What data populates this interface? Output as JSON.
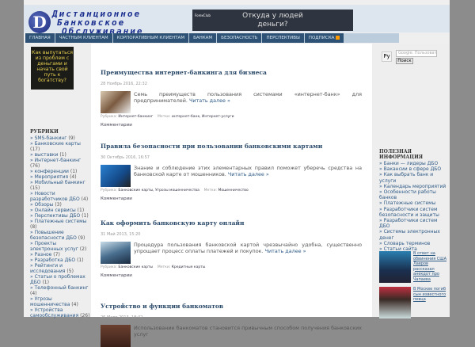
{
  "header": {
    "logo_letter": "D",
    "logo_lines": [
      "Дистанционное",
      "Банковское",
      "Обслуживание"
    ],
    "ad_brand": "ForexClub",
    "ad_text": "Откуда у людей деньги?"
  },
  "nav": [
    "ГЛАВНАЯ",
    "ЧАСТНЫМ КЛИЕНТАМ",
    "КОРПОРАТИВНЫМ КЛИЕНТАМ",
    "БАНКАМ",
    "БЕЗОПАСНОСТЬ",
    "ПЕРСПЕКТИВЫ",
    "ПОДПИСКА"
  ],
  "left": {
    "promo": "Как выпутаться из проблем с деньгами и начать свой путь к богатству?",
    "rubrics_title": "РУБРИКИ",
    "rubrics": [
      {
        "label": "SMS-банкинг",
        "count": "(9)"
      },
      {
        "label": "Банковские карты",
        "count": "(17)"
      },
      {
        "label": "выставки",
        "count": "(1)"
      },
      {
        "label": "Интернет-банкинг",
        "count": "(76)"
      },
      {
        "label": "конференции",
        "count": "(1)"
      },
      {
        "label": "Мероприятия",
        "count": "(4)"
      },
      {
        "label": "Мобильный банкинг",
        "count": "(15)"
      },
      {
        "label": "Новости разработчиков ДБО",
        "count": "(4)"
      },
      {
        "label": "Обзоры",
        "count": "(3)"
      },
      {
        "label": "Онлайн сервисы",
        "count": "(1)"
      },
      {
        "label": "Перспективы ДБО",
        "count": "(1)"
      },
      {
        "label": "Платежные системы",
        "count": "(8)"
      },
      {
        "label": "Повышение безопасности ДБО",
        "count": "(9)"
      },
      {
        "label": "Проекты электронных услуг",
        "count": "(2)"
      },
      {
        "label": "Разное",
        "count": "(7)"
      },
      {
        "label": "Разработка ДБО",
        "count": "(1)"
      },
      {
        "label": "Рейтинги и исследования",
        "count": "(5)"
      },
      {
        "label": "Статьи о проблемах ДБО",
        "count": "(1)"
      },
      {
        "label": "Телефонный банкинг",
        "count": "(4)"
      },
      {
        "label": "Угрозы мошенничества",
        "count": "(4)"
      },
      {
        "label": "Устройства самообслуживания",
        "count": "(26)"
      }
    ]
  },
  "posts": [
    {
      "title": "Преимущества интернет-банкинга для бизнеса",
      "date": "28 Ноябрь 2016, 22:32",
      "excerpt": "Семь преимуществ пользования системами «интернет-банк» для предпринимателей.",
      "more": "Читать далее »",
      "rubric_label": "Рубрика:",
      "rubrics": "Интернет-банкинг",
      "tags_label": "Метки:",
      "tags": "интернет-банк, Интернет-услуги",
      "comments": "Комментарии"
    },
    {
      "title": "Правила безопасности при пользовании банковскими картами",
      "date": "30 Октябрь 2016, 16:57",
      "excerpt": "Знание и соблюдение этих элементарных правил поможет уберечь средства на банковской карте от мошенников.",
      "more": "Читать далее »",
      "rubric_label": "Рубрика:",
      "rubrics": "Банковские карты, Угрозы мошенничества",
      "tags_label": "Метки:",
      "tags": "Мошенничество",
      "comments": "Комментарии"
    },
    {
      "title": "Как оформить банковскую карту онлайн",
      "date": "31 Май 2013, 15:20",
      "excerpt": "Процедура пользования банковской картой чрезвычайно удобна, существенно упрощает процесс оплаты платежей и покупок.",
      "more": "Читать далее »",
      "rubric_label": "Рубрика:",
      "rubrics": "Банковские карты",
      "tags_label": "Метки:",
      "tags": "Кредитные карты",
      "comments": "Комментарии"
    },
    {
      "title": "Устройство и функции банкоматов",
      "date": "26 Март 2013, 18:42",
      "excerpt": "Использование банкоматов становится привычным способом получения банковских услуг"
    }
  ],
  "right": {
    "lang": "Ру",
    "search_placeholder": "Google: Пользовательский поиск",
    "search_button": "Поиск",
    "useful_title": "ПОЛЕЗНАЯ ИНФОРМАЦИЯ",
    "useful": [
      "Банки — лидеры ДБО",
      "Вакансии в сфере ДБО",
      "Как выбрать банк и услуги",
      "Календарь мероприятий",
      "Особенности работы банков",
      "Платежные системы",
      "Разработчики систем безопасности и защиты",
      "Разработчики систем ДБО",
      "Системы электронных денег",
      "Словарь терминов",
      "Статьи сайта"
    ],
    "news": [
      "В ответ на обвинения США Лавров рассказал анекдот про Чапаева",
      "В Москве погиб сын известного певца"
    ]
  }
}
